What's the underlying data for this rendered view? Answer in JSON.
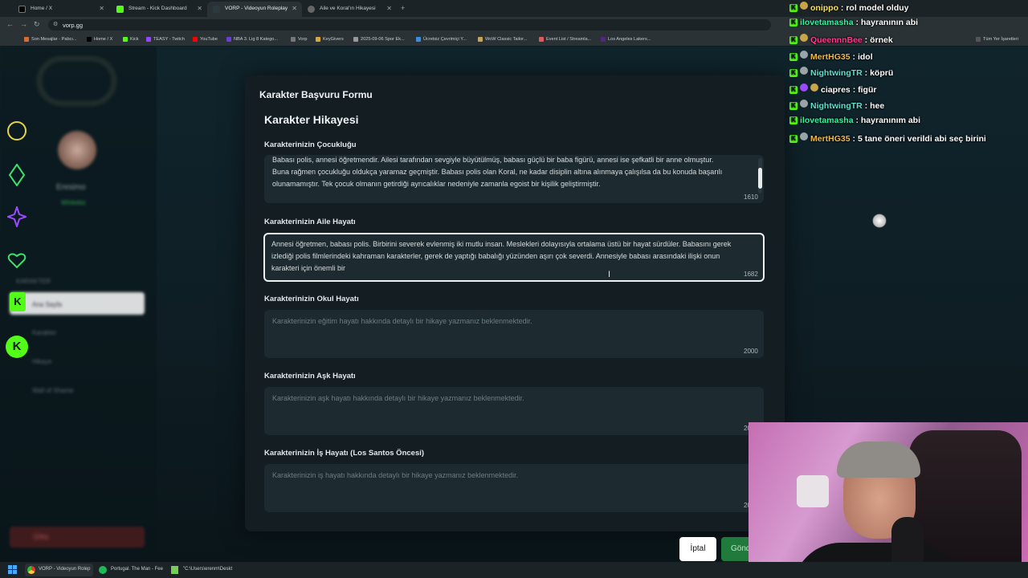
{
  "browser": {
    "tabs": [
      {
        "label": "Home / X",
        "active": false
      },
      {
        "label": "Stream - Kick Dashboard",
        "active": false
      },
      {
        "label": "VORP - Videoyun Roleplay",
        "active": true
      },
      {
        "label": "Aile ve Koral'ın Hikayesi",
        "active": false
      }
    ],
    "new_tab_glyph": "+",
    "url": "vorp.gg",
    "bookmarks": [
      "Son Mesajlar - Pabcı...",
      "Home / X",
      "Kick",
      "TEASY - Twitch",
      "YouTube",
      "NBA 3. Lig 8 Katego...",
      "Vorp",
      "KeyGivers",
      "2025-09-06 Spor Ek...",
      "Ücretsiz Çevrimiçi Y...",
      "WoW Classic Tailor...",
      "Event List / Streamla...",
      "Los Angeles Lakers..."
    ],
    "all_bookmarks": "Tüm Yer İşaretleri"
  },
  "sidebar": {
    "user_name": "Eresimo",
    "status": "Whitelist",
    "items": [
      "Ana Sayfa",
      "Karakter",
      "Hikaye",
      "Wall of Shame"
    ],
    "section": "KARAKTER",
    "footer": "Çıkış"
  },
  "modal": {
    "title": "Karakter Başvuru Formu",
    "section_title": "Karakter Hikayesi",
    "fields": [
      {
        "label": "Karakterinizin Çocukluğu",
        "value": "Babası polis, annesi öğretmendir. Ailesi tarafından sevgiyle büyütülmüş, babası güçlü bir baba figürü, annesi ise şefkatli bir anne olmuştur. Buna rağmen çocukluğu oldukça yaramaz geçmiştir. Babası polis olan Koral, ne kadar disiplin altına alınmaya çalışılsa da bu konuda başarılı olunamamıştır. Tek çocuk olmanın getirdiği ayrıcalıklar nedeniyle zamanla egoist bir kişilik geliştirmiştir.",
        "placeholder": "",
        "counter": "1610"
      },
      {
        "label": "Karakterinizin Aile Hayatı",
        "value": "Annesi öğretmen, babası polis. Birbirini severek evlenmiş iki mutlu insan. Meslekleri dolayısıyla ortalama üstü bir hayat sürdüler. Babasını gerek izlediği polis filmlerindeki kahraman karakterler, gerek de yaptığı babalığı yüzünden aşırı çok severdi. Annesiyle babası arasındaki ilişki onun karakteri için önemli bir",
        "placeholder": "",
        "counter": "1682"
      },
      {
        "label": "Karakterinizin Okul Hayatı",
        "value": "",
        "placeholder": "Karakterinizin eğitim hayatı hakkında detaylı bir hikaye yazmanız beklenmektedir.",
        "counter": "2000"
      },
      {
        "label": "Karakterinizin Aşk Hayatı",
        "value": "",
        "placeholder": "Karakterinizin aşk hayatı hakkında detaylı bir hikaye yazmanız beklenmektedir.",
        "counter": "20"
      },
      {
        "label": "Karakterinizin İş Hayatı (Los Santos Öncesi)",
        "value": "",
        "placeholder": "Karakterinizin iş hayatı hakkında detaylı bir hikaye yazmanız beklenmektedir.",
        "counter": "20"
      }
    ],
    "cancel_label": "İptal",
    "send_label": "Gönd"
  },
  "chat": [
    {
      "user": "onippo",
      "message": "rol model olduy",
      "color": "#f3e36a"
    },
    {
      "user": "ilovetamasha",
      "message": "hayranının abi",
      "color": "#39f3a3"
    },
    {
      "user": "QueennnBee",
      "message": "örnek",
      "color": "#ff3b8d"
    },
    {
      "user": "MertHG35",
      "message": "idol",
      "color": "#f0b848"
    },
    {
      "user": "NightwingTR",
      "message": "köprü",
      "color": "#5fe0d0"
    },
    {
      "user": "ciapres",
      "message": "figür",
      "color": "#ffffff"
    },
    {
      "user": "NightwingTR",
      "message": "hee",
      "color": "#5fe0d0"
    },
    {
      "user": "ilovetamasha",
      "message": "hayranınım abi",
      "color": "#39f3a3"
    },
    {
      "user": "MertHG35",
      "message": "5 tane öneri verildi abi seç birini",
      "color": "#f0b848"
    }
  ],
  "taskbar": {
    "items": [
      "VORP - Videoyun Rolep",
      "Portugal. The Man - Fee",
      "\"C:\\Users\\erenm\\Deskt"
    ]
  },
  "colors": {
    "accent_green": "#53fc18",
    "modal_bg": "#141e22",
    "field_bg": "#1d2a2f"
  }
}
